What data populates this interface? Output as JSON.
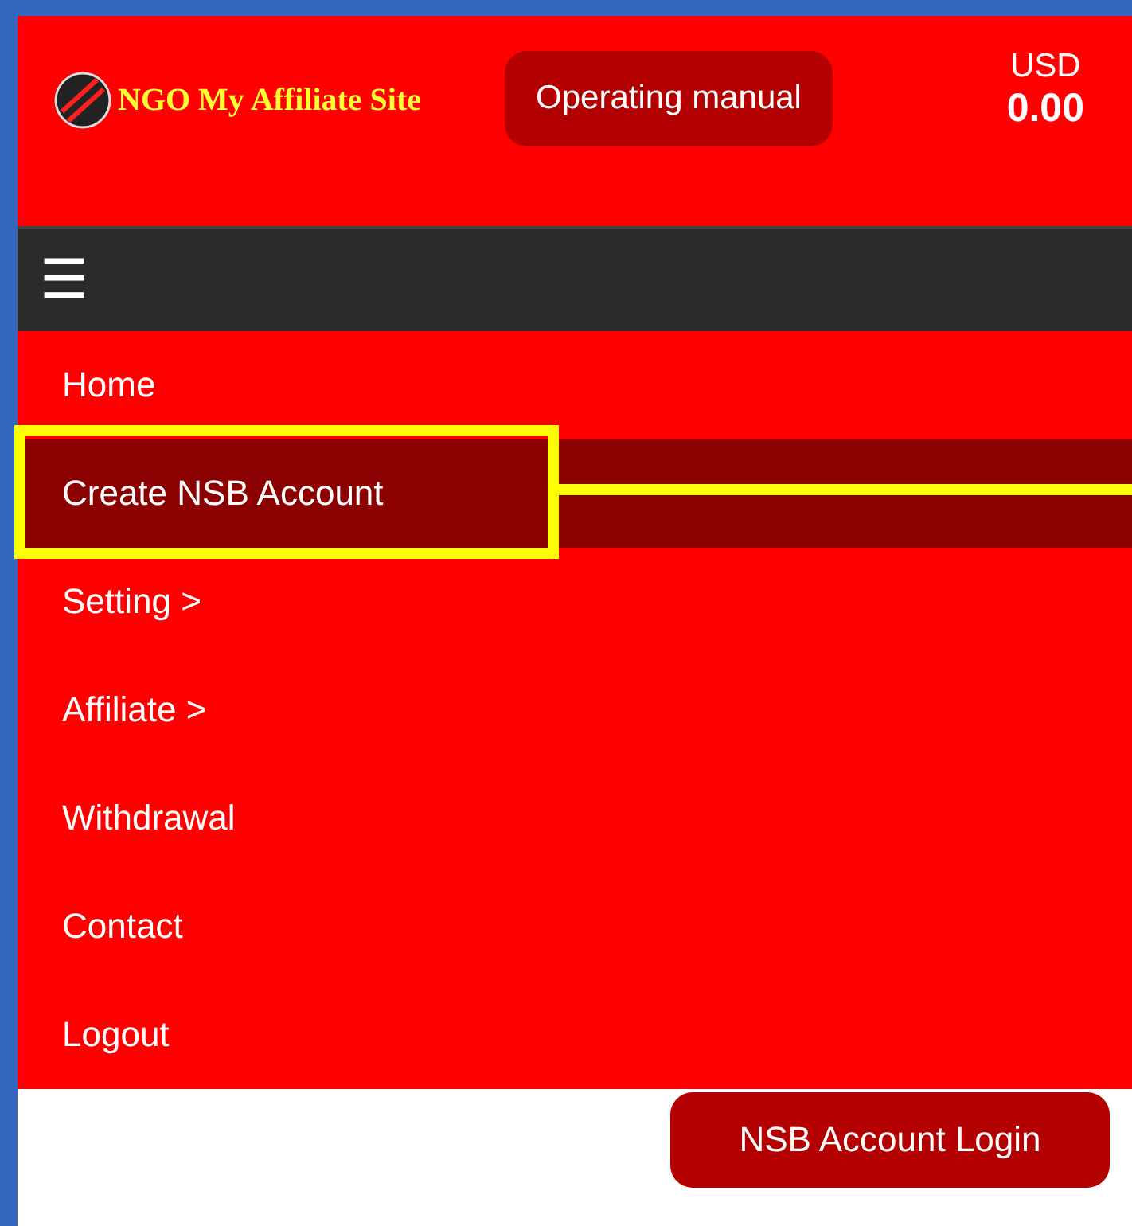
{
  "header": {
    "logo_text": "NGO My Affiliate Site",
    "manual_button": "Operating manual",
    "currency": "USD",
    "balance": "0.00"
  },
  "menu_bar": {
    "icon": "☰"
  },
  "menu": [
    {
      "label": "Home",
      "selected": false,
      "highlighted": false
    },
    {
      "label": "Create NSB Account",
      "selected": true,
      "highlighted": true
    },
    {
      "label": "Setting >",
      "selected": false,
      "highlighted": false
    },
    {
      "label": "Affiliate >",
      "selected": false,
      "highlighted": false
    },
    {
      "label": "Withdrawal",
      "selected": false,
      "highlighted": false
    },
    {
      "label": "Contact",
      "selected": false,
      "highlighted": false
    },
    {
      "label": "Logout",
      "selected": false,
      "highlighted": false
    }
  ],
  "login_button": "NSB Account Login"
}
